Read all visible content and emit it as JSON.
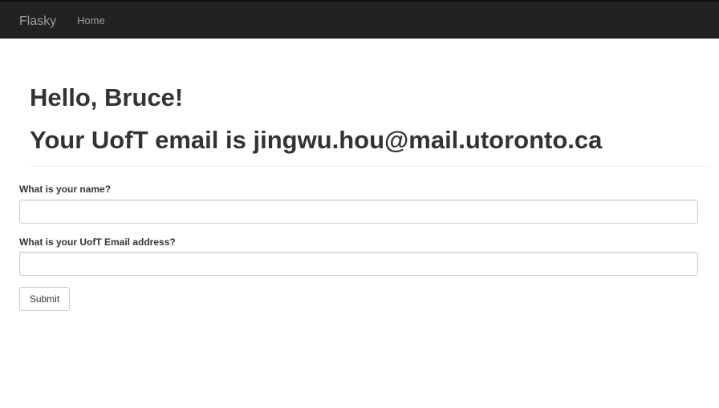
{
  "navbar": {
    "brand": "Flasky",
    "links": [
      {
        "label": "Home"
      }
    ]
  },
  "header": {
    "greeting": "Hello, Bruce!",
    "email_line": "Your UofT email is jingwu.hou@mail.utoronto.ca"
  },
  "form": {
    "name_label": "What is your name?",
    "name_value": "",
    "email_label": "What is your UofT Email address?",
    "email_value": "",
    "submit_label": "Submit"
  },
  "colors": {
    "navbar_bg": "#222222",
    "navbar_text": "#9d9d9d",
    "body_text": "#333333",
    "input_border": "#cccccc"
  }
}
